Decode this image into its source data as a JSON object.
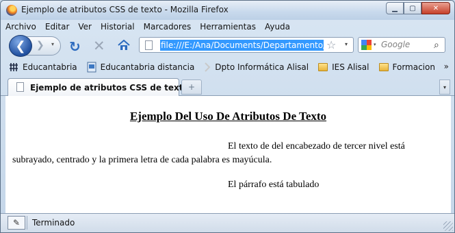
{
  "window": {
    "title": "Ejemplo de atributos CSS de texto - Mozilla Firefox",
    "controls": {
      "minimize": "▁",
      "maximize": "▢",
      "close": "✕"
    }
  },
  "menubar": {
    "items": [
      "Archivo",
      "Editar",
      "Ver",
      "Historial",
      "Marcadores",
      "Herramientas",
      "Ayuda"
    ]
  },
  "navbar": {
    "back_icon": "❮",
    "forward_icon": "❯",
    "dropdown_icon": "▾",
    "reload_icon": "↻",
    "stop_icon": "✕",
    "url": "file:///E:/Ana/Documents/Departamento/ASI",
    "star_icon": "☆",
    "search_placeholder": "Google",
    "search_icon": "⌕"
  },
  "bookmarks": {
    "items": [
      {
        "label": "Educantabria",
        "icon": "grid-icon"
      },
      {
        "label": "Educantabria distancia",
        "icon": "page-blue-icon"
      },
      {
        "label": "Dpto Informática Alisal",
        "icon": "arrow-icon"
      },
      {
        "label": "IES Alisal",
        "icon": "folder-icon"
      },
      {
        "label": "Formacion",
        "icon": "folder-icon"
      }
    ],
    "chevron": "»"
  },
  "tabs": {
    "active_label": "Ejemplo de atributos CSS de texto",
    "new_tab": "+",
    "list_icon": "▾"
  },
  "content": {
    "heading": "Ejemplo Del Uso De Atributos De Texto",
    "paragraph1": "El texto de del encabezado de tercer nivel está subrayado, centrado y la primera letra de cada palabra es mayúcula.",
    "paragraph2": "El párrafo está tabulado"
  },
  "statusbar": {
    "text": "Terminado",
    "icon": "✎"
  },
  "colors": {
    "url_highlight": "#3399ff",
    "chrome_bg": "#c9d9ea",
    "back_button": "#21509f"
  }
}
